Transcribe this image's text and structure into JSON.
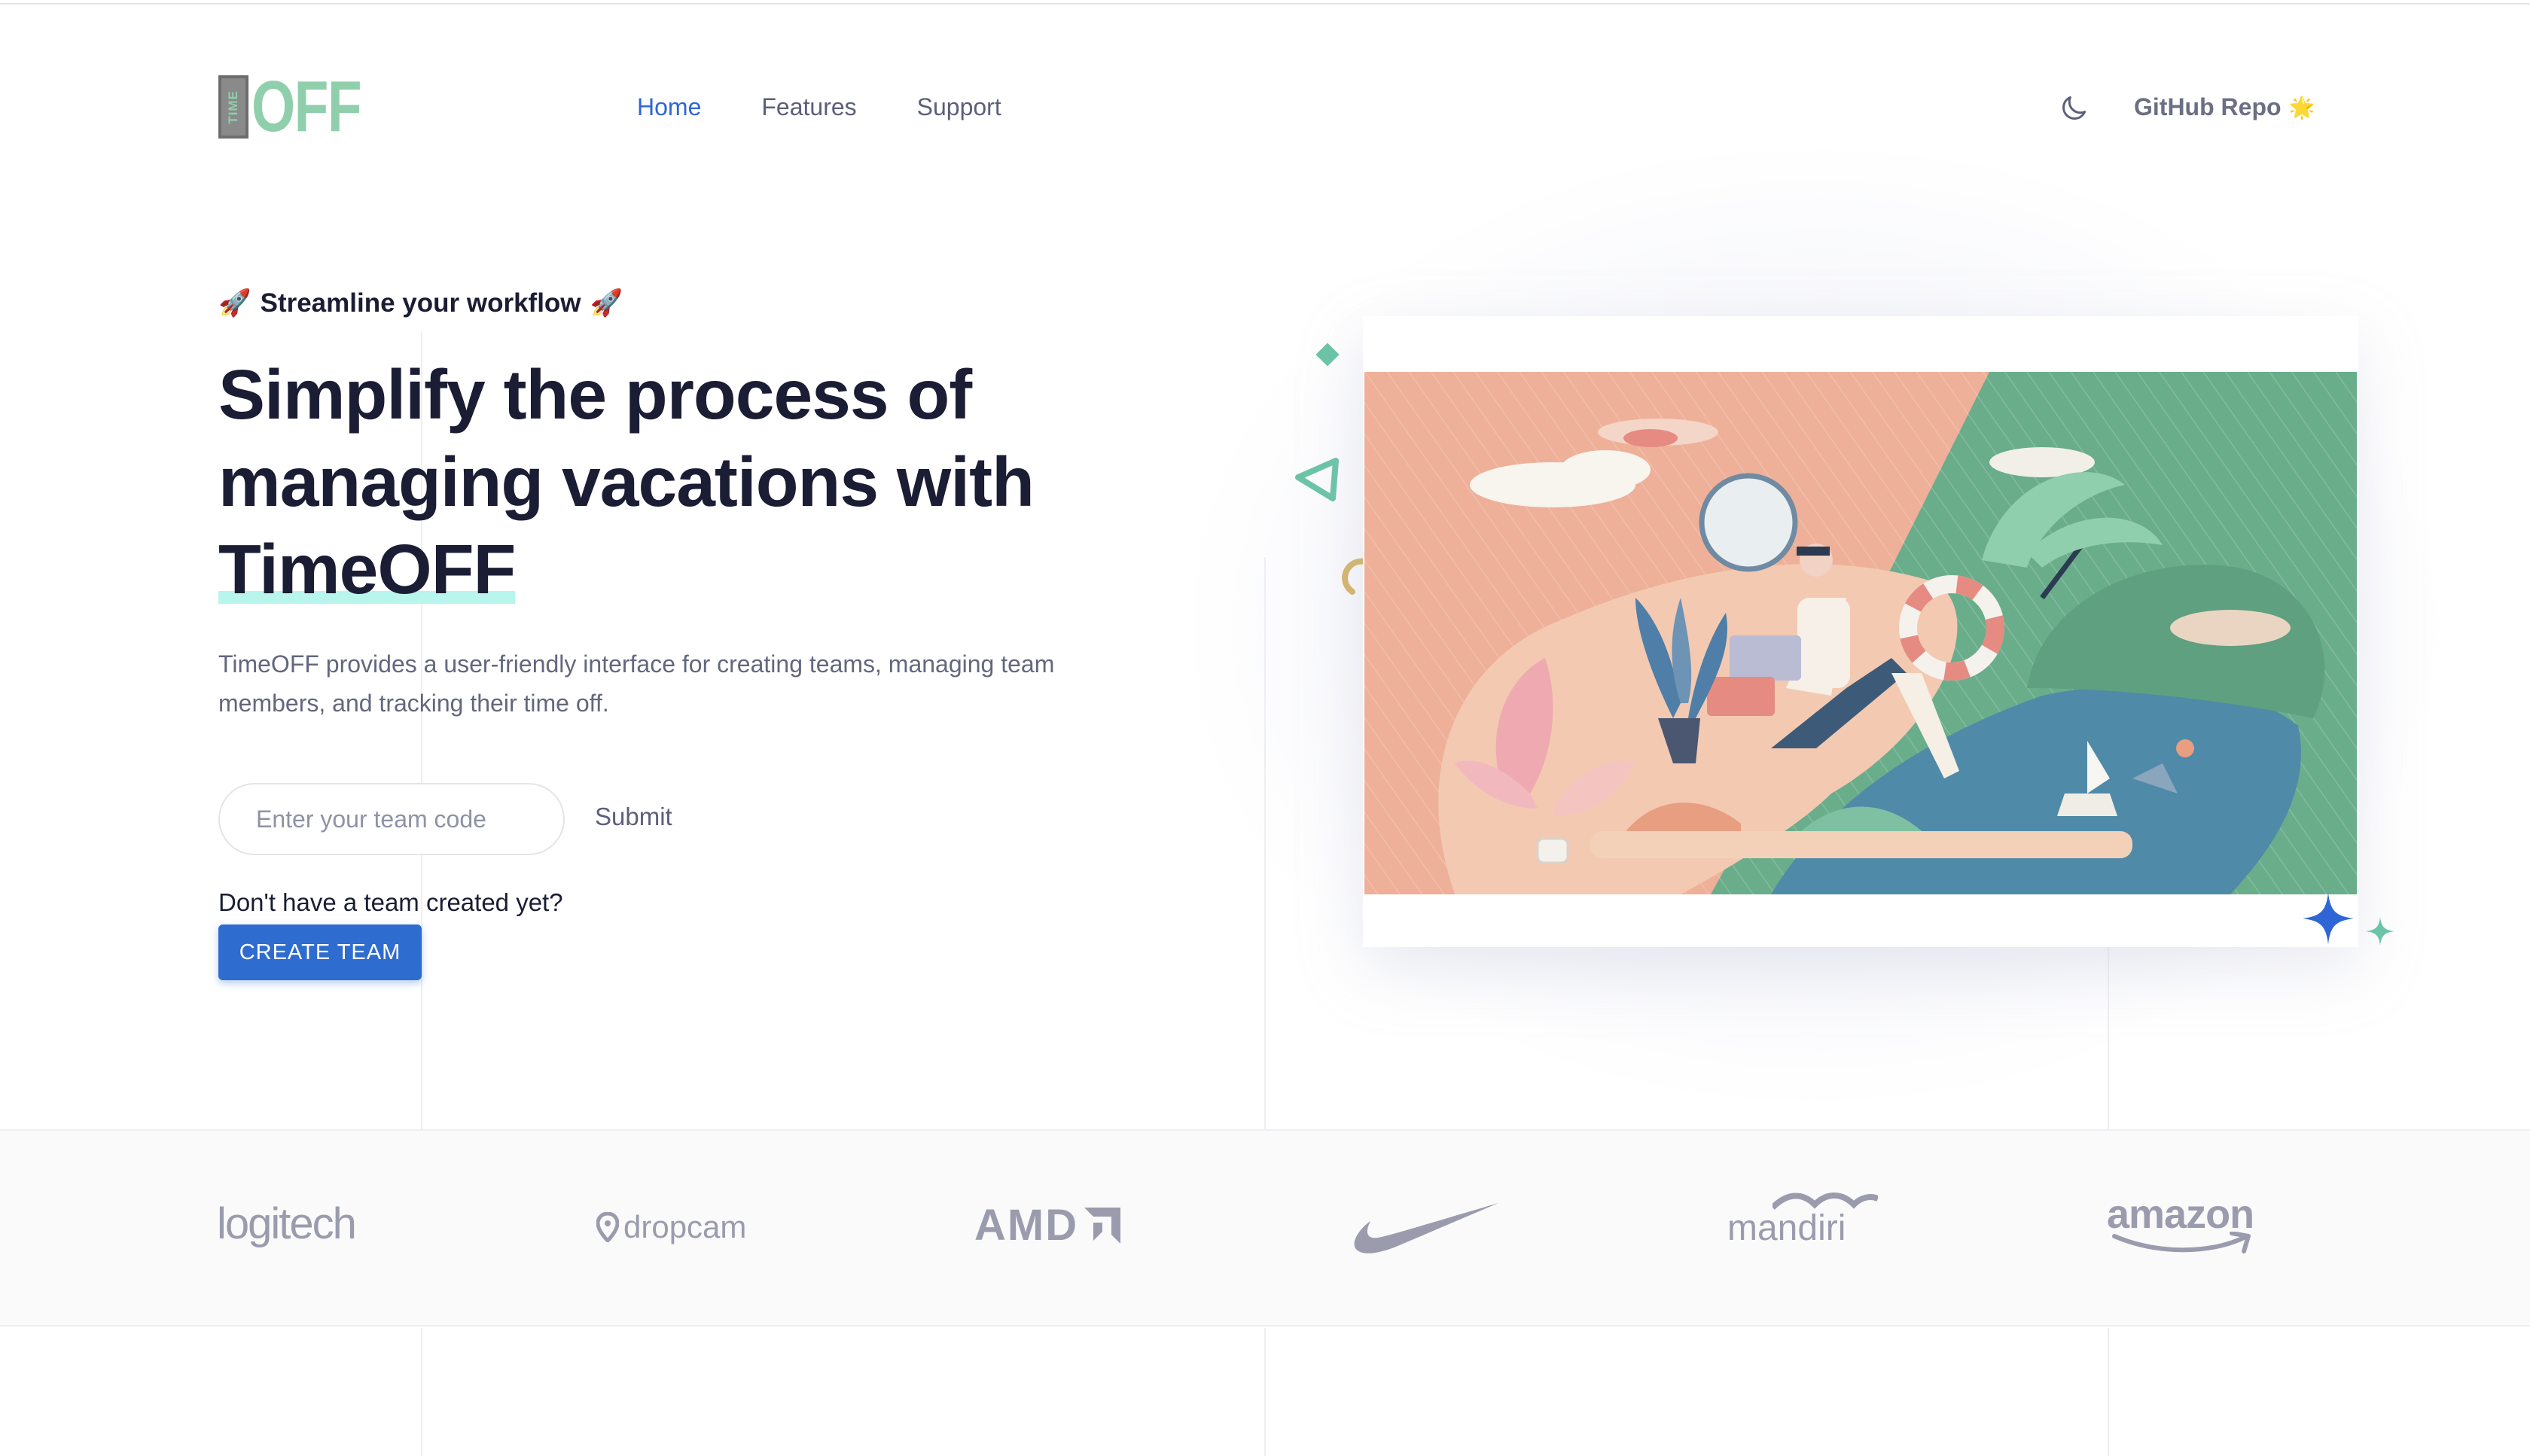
{
  "header": {
    "logo_text": "OFF",
    "logo_box_text": "TIME",
    "nav": [
      {
        "label": "Home",
        "active": true
      },
      {
        "label": "Features",
        "active": false
      },
      {
        "label": "Support",
        "active": false
      }
    ],
    "theme_toggle_icon": "moon-icon",
    "github_label": "GitHub Repo",
    "github_emoji": "🌟"
  },
  "hero": {
    "eyebrow_text": "Streamline your workflow",
    "eyebrow_emoji": "🚀",
    "headline_line1": "Simplify the process of",
    "headline_line2": "managing vacations with",
    "headline_highlight": "TimeOFF",
    "description": "TimeOFF provides a user-friendly interface for creating teams, managing team members, and tracking their time off.",
    "team_code_placeholder": "Enter your team code",
    "team_code_value": "",
    "submit_label": "Submit",
    "no_team_text": "Don't have a team created yet?",
    "create_team_label": "CREATE TEAM"
  },
  "brands": {
    "logitech": "logitech",
    "dropcam": "dropcam",
    "amd": "AMD",
    "mandiri": "mandiri",
    "amazon": "amazon"
  },
  "colors": {
    "accent": "#2f66d6",
    "button": "#2f6ccf",
    "logo_green": "#8fcfab",
    "highlight": "#b8f5ec",
    "brand_gray": "#9a9cae"
  }
}
